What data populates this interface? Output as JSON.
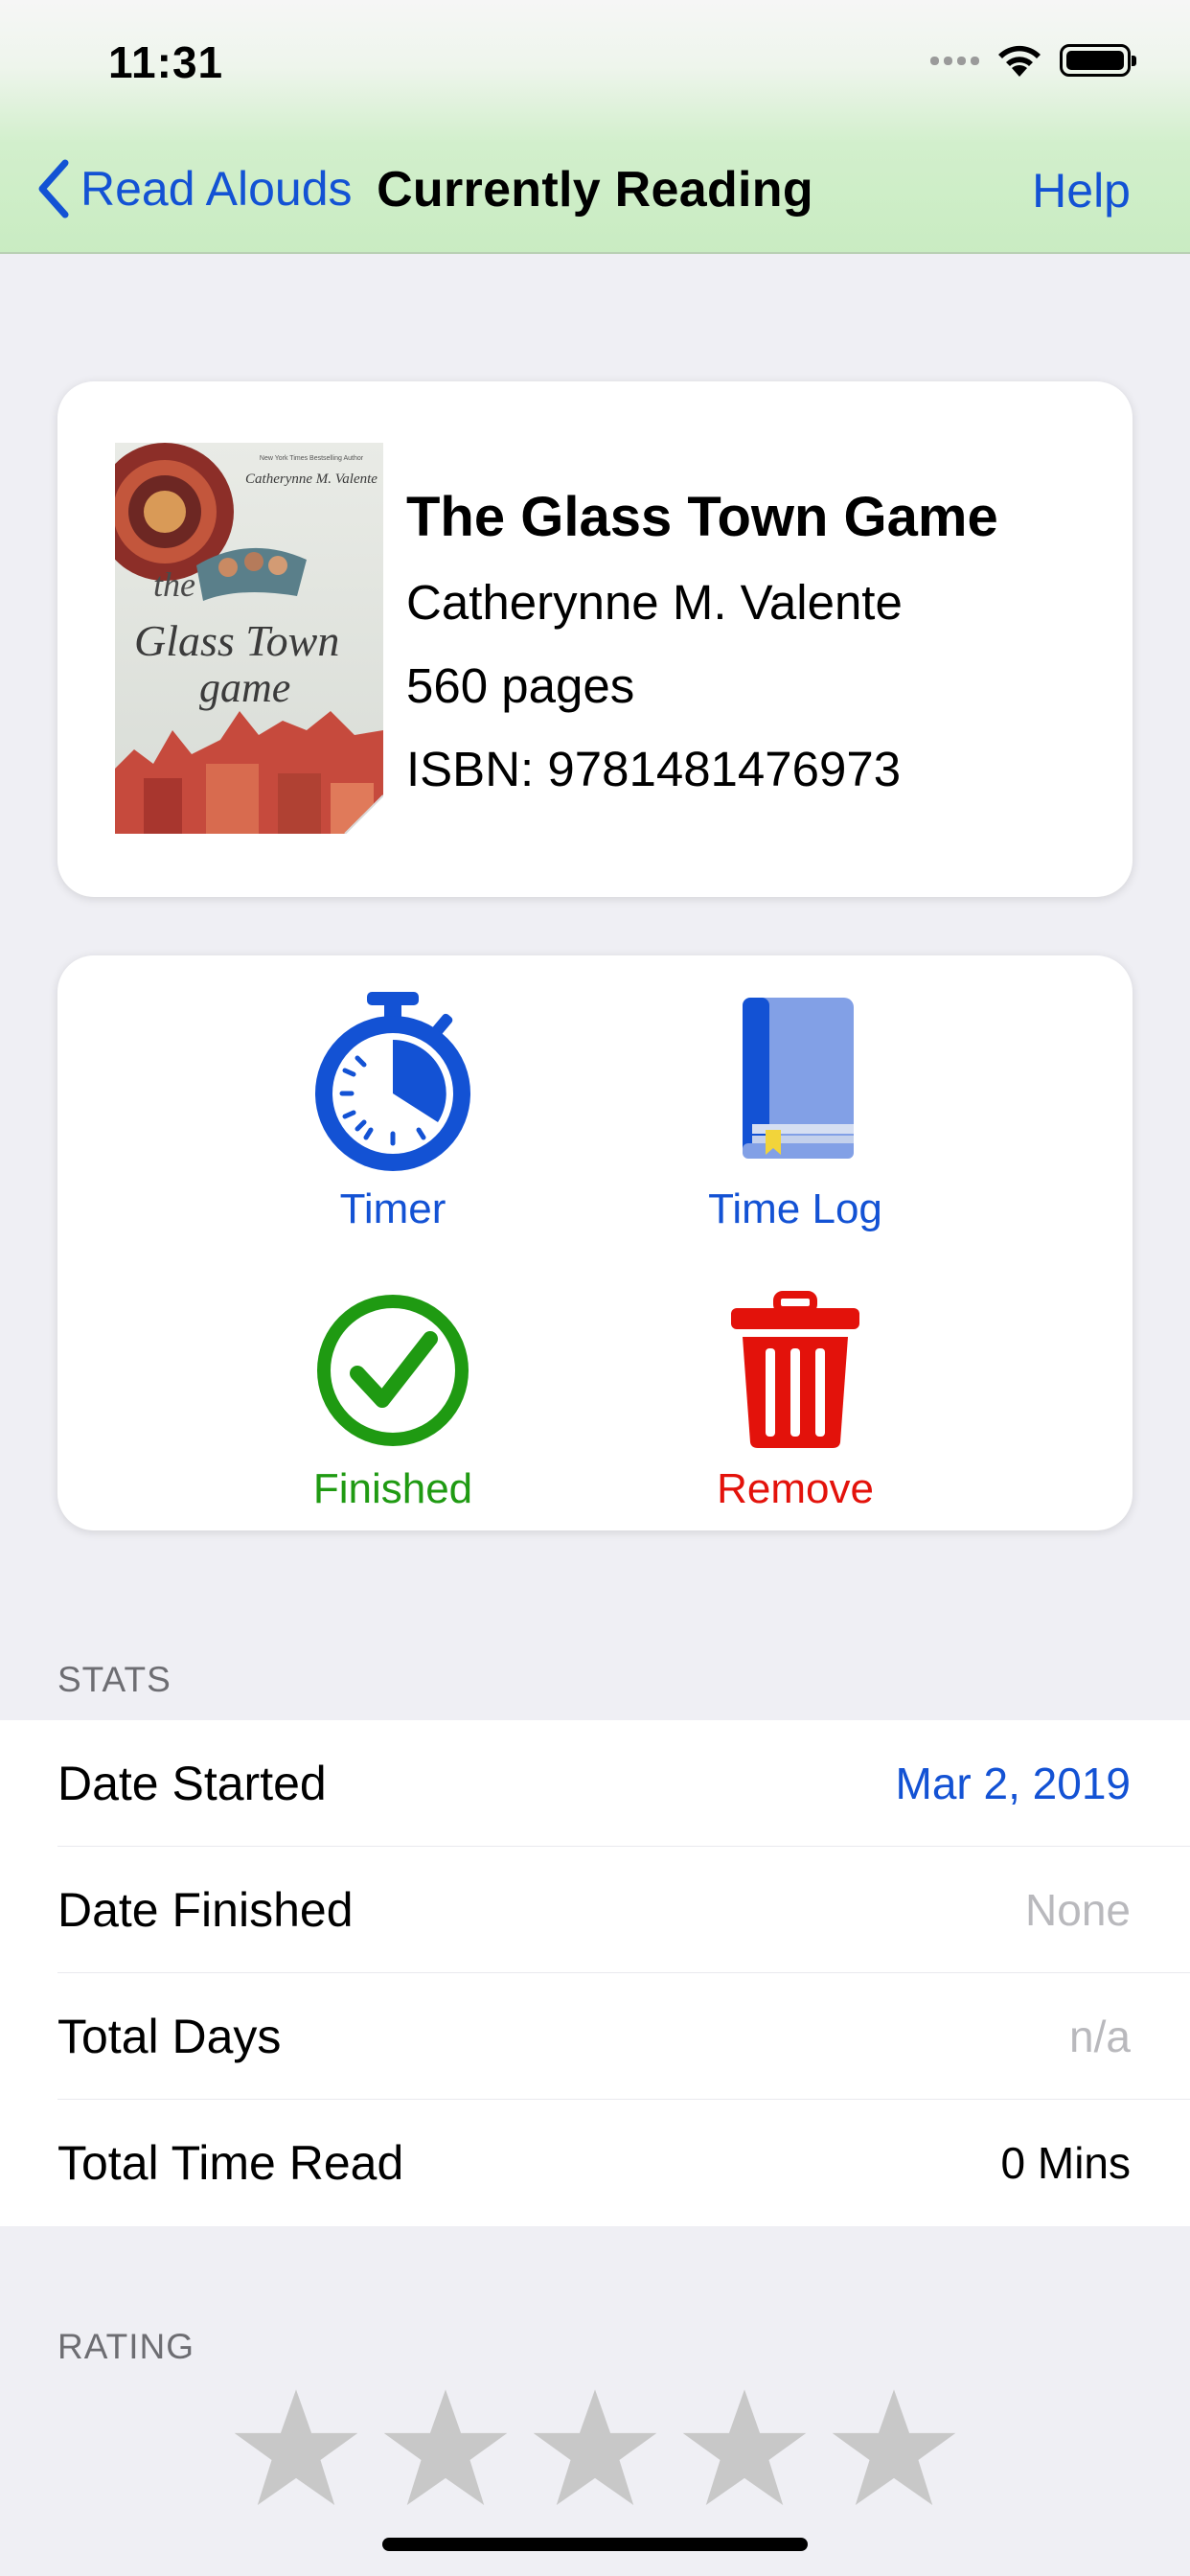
{
  "status_bar": {
    "time": "11:31"
  },
  "nav": {
    "back_label": "Read Alouds",
    "title": "Currently Reading",
    "help_label": "Help"
  },
  "book": {
    "title": "The Glass Town Game",
    "author": "Catherynne M. Valente",
    "pages": "560 pages",
    "isbn": "ISBN: 9781481476973",
    "cover": {
      "title_art": "the Glass Town game",
      "byline": "Catherynne M. Valente",
      "top_tag": "New York Times Bestselling Author"
    }
  },
  "actions": [
    {
      "label": "Timer",
      "icon": "stopwatch-icon",
      "color": "#1352d4"
    },
    {
      "label": "Time Log",
      "icon": "book-icon",
      "color": "#1352d4"
    },
    {
      "label": "Finished",
      "icon": "checkmark-circle-icon",
      "color": "#1f9a12"
    },
    {
      "label": "Remove",
      "icon": "trash-icon",
      "color": "#e3120b"
    }
  ],
  "stats": {
    "header": "STATS",
    "rows": [
      {
        "label": "Date Started",
        "value": "Mar 2, 2019"
      },
      {
        "label": "Date Finished",
        "value": "None"
      },
      {
        "label": "Total Days",
        "value": "n/a"
      },
      {
        "label": "Total Time Read",
        "value": "0 Mins"
      }
    ]
  },
  "rating": {
    "header": "RATING",
    "value": 0,
    "max": 5
  },
  "colors": {
    "accent": "#1352d4",
    "green": "#1f9a12",
    "red": "#e3120b",
    "star": "#c8c8c8"
  }
}
